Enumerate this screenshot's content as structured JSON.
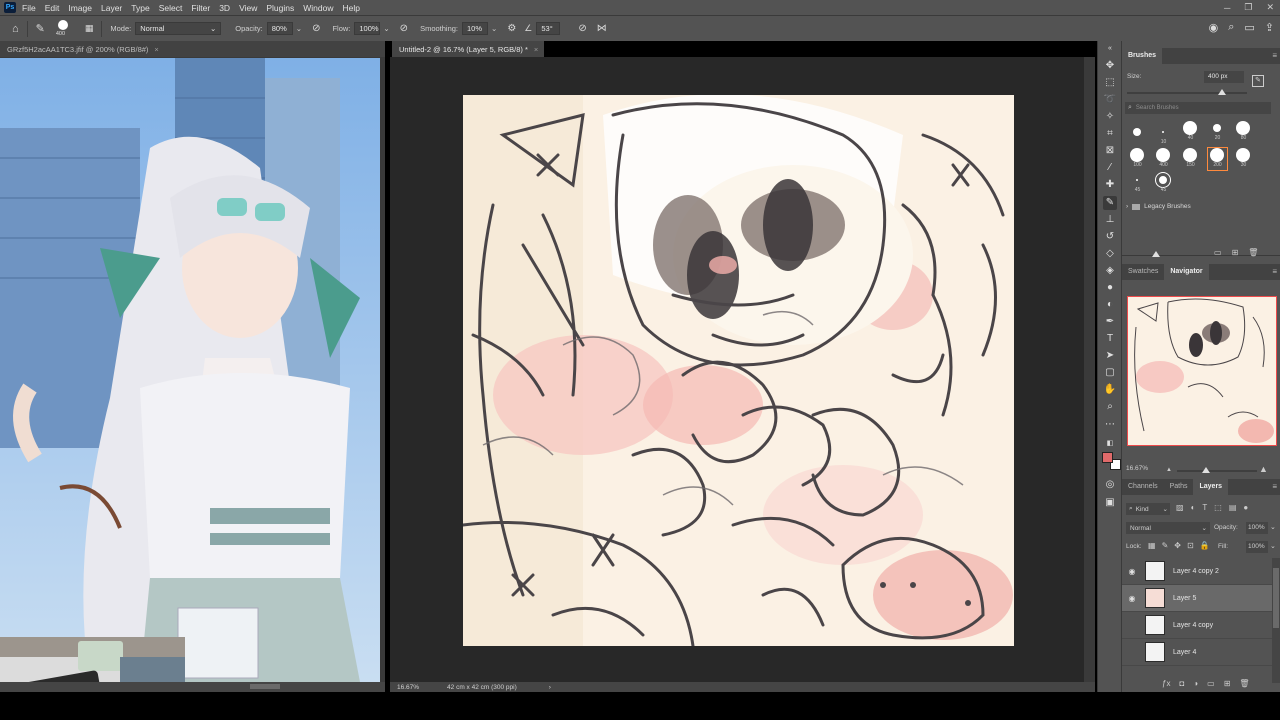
{
  "menu": [
    "File",
    "Edit",
    "Image",
    "Layer",
    "Type",
    "Select",
    "Filter",
    "3D",
    "View",
    "Plugins",
    "Window",
    "Help"
  ],
  "options": {
    "brush_size": "400",
    "mode_label": "Mode:",
    "mode_value": "Normal",
    "opacity_label": "Opacity:",
    "opacity_value": "80%",
    "flow_label": "Flow:",
    "flow_value": "100%",
    "smoothing_label": "Smoothing:",
    "smoothing_value": "10%",
    "angle_value": "53°"
  },
  "tabs": {
    "left_doc": "GRzf5H2acAA1TC3.jfif @ 200% (RGB/8#)",
    "main_doc": "Untitled-2 @ 16.7% (Layer 5, RGB/8) *",
    "close": "×"
  },
  "status": {
    "zoom": "16.67%",
    "doc_info": "42 cm x 42 cm (300 ppi)",
    "arrow": "›"
  },
  "brushes": {
    "title": "Brushes",
    "size_label": "Size:",
    "size_value": "400 px",
    "search_placeholder": "Search Brushes",
    "presets": [
      {
        "label": ""
      },
      {
        "label": "10"
      },
      {
        "label": "40"
      },
      {
        "label": "20"
      },
      {
        "label": "80"
      },
      {
        "label": "100"
      },
      {
        "label": "400"
      },
      {
        "label": "150"
      },
      {
        "label": "200"
      },
      {
        "label": "30"
      },
      {
        "label": "45"
      },
      {
        "label": "45"
      }
    ],
    "folder": "Legacy Brushes"
  },
  "navigator": {
    "tabs": [
      "Swatches",
      "Navigator"
    ],
    "zoom": "16.67%"
  },
  "layers": {
    "tabs": [
      "Channels",
      "Paths",
      "Layers"
    ],
    "kind_label": "Kind",
    "blend_mode": "Normal",
    "opacity_label": "Opacity:",
    "opacity_value": "100%",
    "lock_label": "Lock:",
    "fill_label": "Fill:",
    "fill_value": "100%",
    "items": [
      {
        "name": "Layer 4 copy 2"
      },
      {
        "name": "Layer 5"
      },
      {
        "name": "Layer 4 copy"
      },
      {
        "name": "Layer 4"
      }
    ]
  },
  "colors": {
    "foreground": "#e06a6a",
    "background": "#ffffff",
    "accent": "#ff8a3d"
  }
}
